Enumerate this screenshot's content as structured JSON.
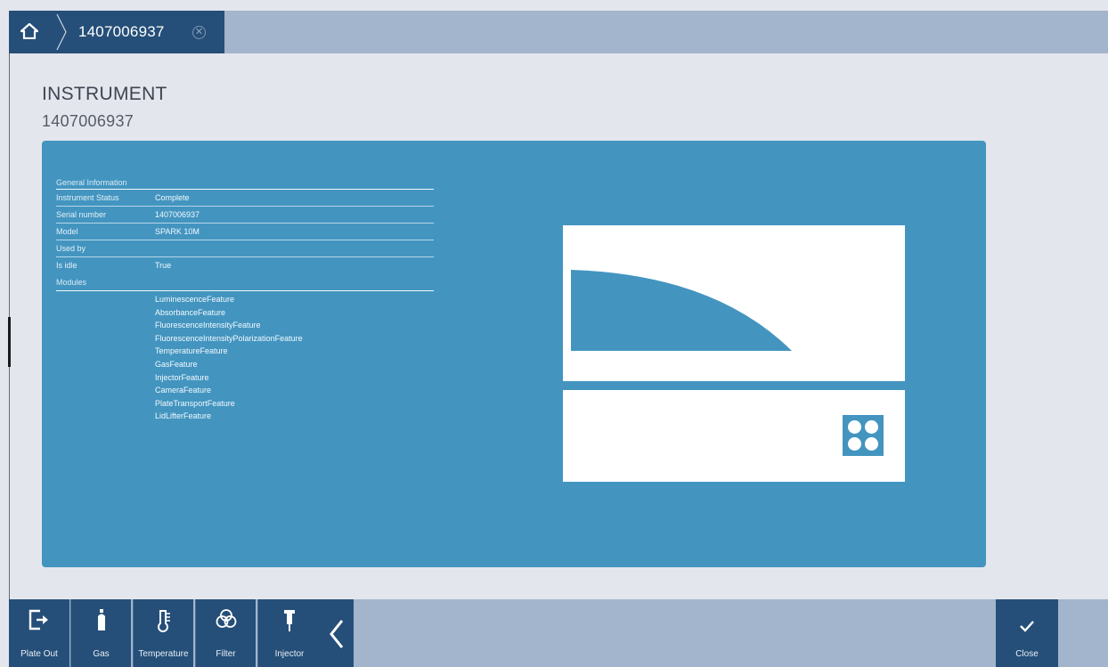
{
  "header": {
    "tab_title": "1407006937",
    "home_icon": "home-icon",
    "close_tab_icon": "close-circle-icon"
  },
  "page": {
    "title": "INSTRUMENT",
    "subtitle": "1407006937"
  },
  "info": {
    "general_header": "General Information",
    "rows": [
      {
        "label": "Instrument Status",
        "value": "Complete"
      },
      {
        "label": "Serial number",
        "value": "1407006937"
      },
      {
        "label": "Model",
        "value": "SPARK 10M"
      },
      {
        "label": "Used by",
        "value": ""
      },
      {
        "label": "Is idle",
        "value": "True"
      }
    ],
    "modules_header": "Modules",
    "modules": [
      "LuminescenceFeature",
      "AbsorbanceFeature",
      "FluorescenceIntensityFeature",
      "FluorescenceIntensityPolarizationFeature",
      "TemperatureFeature",
      "GasFeature",
      "InjectorFeature",
      "CameraFeature",
      "PlateTransportFeature",
      "LidLifterFeature"
    ]
  },
  "toolbar": {
    "buttons": [
      {
        "label": "Plate Out",
        "icon": "plate-out-icon"
      },
      {
        "label": "Gas",
        "icon": "gas-bottle-icon"
      },
      {
        "label": "Temperature",
        "icon": "thermometer-icon"
      },
      {
        "label": "Filter",
        "icon": "filter-icon"
      },
      {
        "label": "Injector",
        "icon": "injector-icon"
      }
    ],
    "collapse_icon": "chevron-left-icon",
    "close_label": "Close",
    "close_icon": "checkmark-icon"
  },
  "colors": {
    "dark_blue": "#254f78",
    "panel_blue": "#4395c0",
    "bar_grey_blue": "#a2b5cc",
    "page_bg": "#e4e6ee"
  }
}
